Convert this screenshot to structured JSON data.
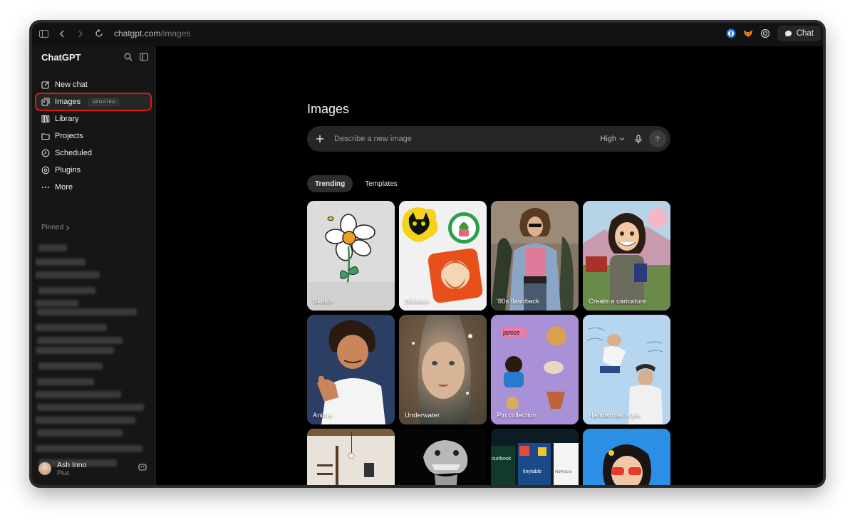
{
  "browser": {
    "url_host": "chatgpt.com",
    "url_path": "/images",
    "chat_button_label": "Chat"
  },
  "sidebar": {
    "brand": "ChatGPT",
    "items": [
      {
        "label": "New chat",
        "icon": "compose-icon"
      },
      {
        "label": "Images",
        "icon": "images-icon",
        "badge": "UPDATED",
        "active": true
      },
      {
        "label": "Library",
        "icon": "library-icon"
      },
      {
        "label": "Projects",
        "icon": "folder-icon"
      },
      {
        "label": "Scheduled",
        "icon": "clock-icon"
      },
      {
        "label": "Plugins",
        "icon": "plugins-icon"
      },
      {
        "label": "More",
        "icon": "more-dots-icon"
      }
    ],
    "pinned_label": "Pinned",
    "user": {
      "name": "Ash Inno",
      "plan": "Plus"
    }
  },
  "main": {
    "title": "Images",
    "prompt": {
      "placeholder": "Describe a new image",
      "quality": "High"
    },
    "tabs": [
      {
        "label": "Trending",
        "active": true
      },
      {
        "label": "Templates",
        "active": false
      }
    ],
    "cards": [
      {
        "label": "Sketch"
      },
      {
        "label": "Stickers"
      },
      {
        "label": "'80s flashback"
      },
      {
        "label": "Create a caricature"
      },
      {
        "label": "Anime"
      },
      {
        "label": "Underwater"
      },
      {
        "label": "Pin collection",
        "text_in_art": "janice"
      },
      {
        "label": "Handwritten style"
      },
      {
        "label": ""
      },
      {
        "label": ""
      },
      {
        "label": "",
        "text_in_art": [
          "ourtbook",
          "tinytable",
          "PEPPER M"
        ]
      },
      {
        "label": ""
      }
    ]
  },
  "colors": {
    "highlight": "#e0141a",
    "background": "#000000",
    "sidebar": "#161616"
  }
}
